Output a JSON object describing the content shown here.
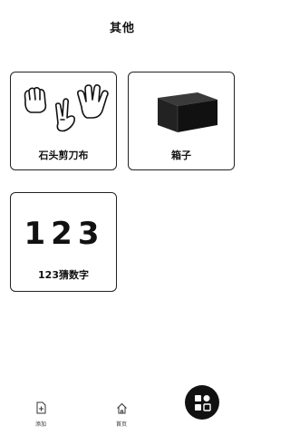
{
  "header": {
    "title": "其他"
  },
  "cards": [
    {
      "label": "石头剪刀布",
      "icon": "rock-paper-scissors-hands-icon"
    },
    {
      "label": "箱子",
      "icon": "black-box-icon"
    },
    {
      "label": "123猜数字",
      "icon": "number-123-icon",
      "art_text": "123"
    }
  ],
  "tabbar": {
    "items": [
      {
        "label": "添加",
        "icon": "add-document-icon"
      },
      {
        "label": "首页",
        "icon": "home-icon"
      }
    ],
    "fab_icon": "apps-grid-icon"
  }
}
